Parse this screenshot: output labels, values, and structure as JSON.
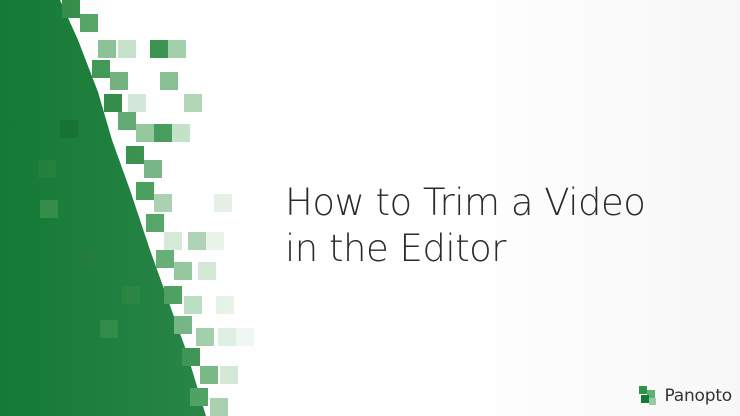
{
  "title_lines": [
    "How to Trim a Video",
    "in the Editor"
  ],
  "brand": {
    "name": "Panopto",
    "icon": "panopto-logo-icon"
  },
  "colors": {
    "green_dark": "#147a35",
    "green_mid": "#2f9447",
    "green_light": "#9bc9a3",
    "title_text": "#2b2b2b"
  }
}
